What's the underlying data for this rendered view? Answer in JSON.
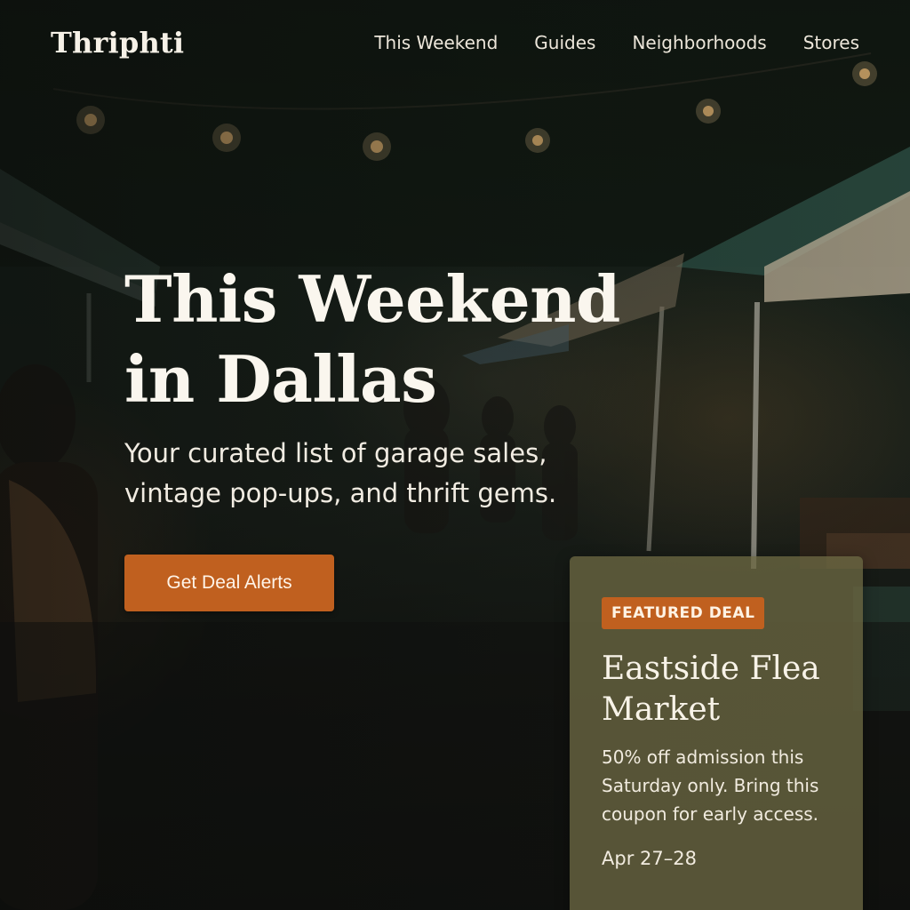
{
  "brand": {
    "logo": "Thriphti"
  },
  "nav": {
    "items": [
      {
        "label": "This Weekend"
      },
      {
        "label": "Guides"
      },
      {
        "label": "Neighborhoods"
      },
      {
        "label": "Stores"
      }
    ]
  },
  "hero": {
    "title_line1": "This Weekend",
    "title_line2": "in Dallas",
    "subtitle_line1": "Your curated list of garage sales,",
    "subtitle_line2": "vintage pop-ups, and thrift gems.",
    "cta_label": "Get Deal Alerts"
  },
  "featured": {
    "badge": "FEATURED DEAL",
    "title_line1": "Eastside Flea",
    "title_line2": "Market",
    "desc_line1": "50% off admission this",
    "desc_line2": "Saturday only. Bring this",
    "desc_line3": "coupon for early access.",
    "date": "Apr 27–28"
  },
  "colors": {
    "accent": "#c0601f",
    "card_bg": "#6c6842",
    "text": "#f3efe6"
  },
  "icons": {
    "background": "market-photo-background"
  }
}
